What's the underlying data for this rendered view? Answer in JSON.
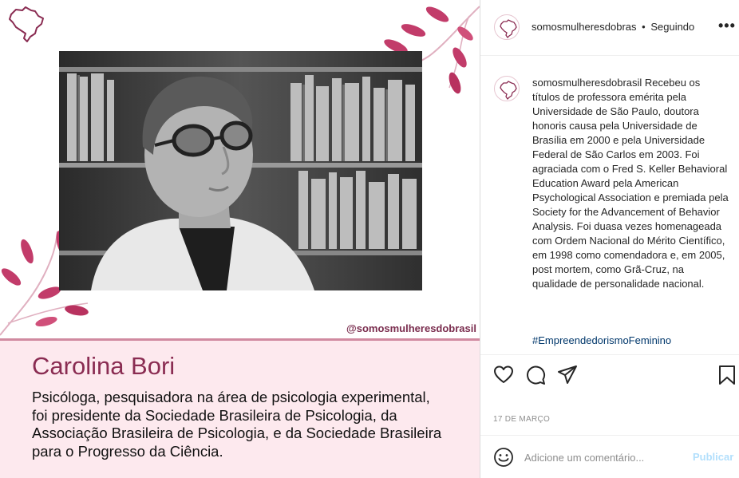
{
  "post": {
    "handle_tag": "@somosmulheresdobrasil",
    "person_name": "Carolina Bori",
    "person_bio": "Psicóloga, pesquisadora na área de psicologia experimental, foi presidente da Sociedade Brasileira de Psicologia, da Associação Brasileira de Psicologia, e da Sociedade Brasileira para o Progresso da Ciência."
  },
  "header": {
    "username": "somosmulheresdobras",
    "separator": "•",
    "follow_label": "Seguindo",
    "more_label": "•••"
  },
  "comment": {
    "username": "somosmulheresdobrasil",
    "text": "Recebeu os títulos de professora emérita pela Universidade de São Paulo, doutora honoris causa pela Universidade de Brasília em 2000 e pela Universidade Federal de São Carlos em 2003. Foi agraciada com o Fred S. Keller Behavioral Education Award pela American Psychological Association e premiada pela Society for the Advancement of Behavior Analysis. Foi duasa vezes homenageada com Ordem Nacional do Mérito Científico, em 1998 como comendadora e, em 2005, post mortem, como Grã-Cruz, na qualidade de personalidade nacional.",
    "hashtag": "#EmpreendedorismoFeminino"
  },
  "date": "17 DE MARÇO",
  "comment_box": {
    "placeholder": "Adicione um comentário...",
    "publish_label": "Publicar"
  },
  "icons": [
    "brazil-map-icon",
    "heart-icon",
    "comment-icon",
    "share-icon",
    "bookmark-icon",
    "emoji-icon"
  ],
  "colors": {
    "accent": "#8a2c52",
    "caption_bg": "#fde9ee",
    "link": "#00376b",
    "publish_disabled": "#b2dffc"
  }
}
